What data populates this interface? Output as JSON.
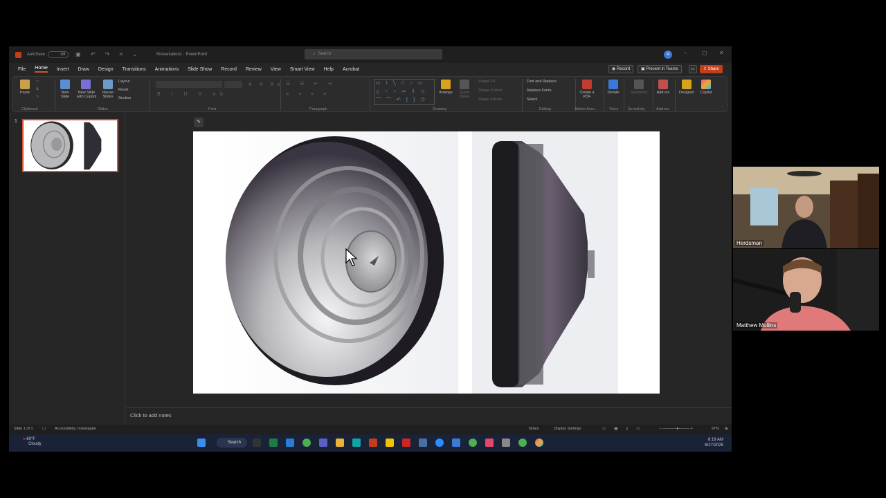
{
  "window": {
    "autosave_label": "AutoSave",
    "autosave_state": "Off",
    "doc_title": "Presentation1 · PowerPoint",
    "search_placeholder": "Search",
    "account_initial": "JF",
    "minimize": "–",
    "maximize": "▢",
    "close": "✕"
  },
  "menu": {
    "items": [
      "File",
      "Home",
      "Insert",
      "Draw",
      "Design",
      "Transitions",
      "Animations",
      "Slide Show",
      "Record",
      "Review",
      "View",
      "Smart View",
      "Help",
      "Acrobat"
    ],
    "active": "Home"
  },
  "ribbon_right": {
    "record": "Record",
    "present": "Present in Teams",
    "share": "Share"
  },
  "ribbon": {
    "clipboard": {
      "paste": "Paste",
      "group": "Clipboard"
    },
    "slides": {
      "new_slide": "New Slide",
      "new_slide_copilot": "New Slide with Copilot",
      "reuse": "Reuse Slides",
      "layout": "Layout",
      "reset": "Reset",
      "section": "Section",
      "group": "Slides"
    },
    "font": {
      "group": "Font"
    },
    "paragraph": {
      "group": "Paragraph"
    },
    "drawing": {
      "arrange": "Arrange",
      "quick_styles": "Quick Styles",
      "shape_fill": "Shape Fill",
      "shape_outline": "Shape Outline",
      "shape_effects": "Shape Effects",
      "group": "Drawing"
    },
    "editing": {
      "find_replace": "Find and Replace",
      "replace_fonts": "Replace Fonts",
      "select": "Select",
      "group": "Editing"
    },
    "adobe": {
      "create_pdf": "Create a PDF",
      "group": "Adobe Acro..."
    },
    "voice": {
      "dictate": "Dictate",
      "group": "Voice"
    },
    "sensitivity": {
      "label": "Sensitivity",
      "group": "Sensitivity"
    },
    "addins": {
      "label": "Add-ins",
      "group": "Add-ins"
    },
    "designer": "Designer",
    "copilot": "Copilot"
  },
  "slide_pane": {
    "slide_number": "1"
  },
  "notes": {
    "placeholder": "Click to add notes"
  },
  "status": {
    "slide": "Slide 1 of 1",
    "accessibility": "Accessibility: Investigate",
    "notes": "Notes",
    "display": "Display Settings",
    "zoom": "97%"
  },
  "taskbar": {
    "temp": "60°F",
    "condition": "Cloudy",
    "search": "Search",
    "time": "8:19 AM",
    "date": "6/27/2025"
  },
  "participants": [
    {
      "name": "Herdsman"
    },
    {
      "name": "Matthew Mullins"
    }
  ]
}
